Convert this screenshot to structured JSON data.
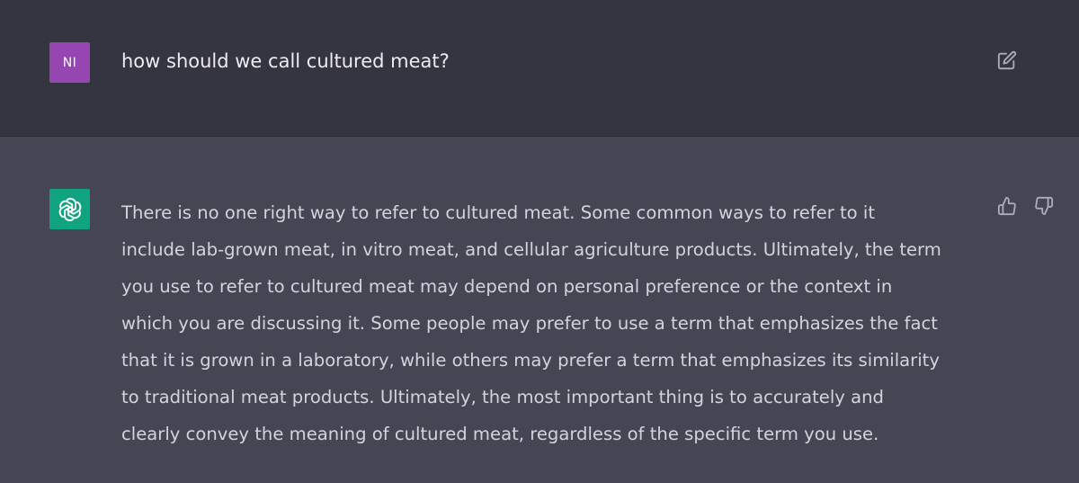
{
  "user_message": {
    "avatar_initials": "NI",
    "avatar_color": "#9646b0",
    "text": "how should we call cultured meat?",
    "edit_icon": "edit-icon"
  },
  "assistant_message": {
    "avatar_icon": "openai-logo-icon",
    "avatar_color": "#10a37f",
    "lines": [
      "There is no one right way to refer to cultured meat. Some common ways to refer to it",
      "include lab-grown meat, in vitro meat, and cellular agriculture products. Ultimately, the term",
      "you use to refer to cultured meat may depend on personal preference or the context in",
      "which you are discussing it. Some people may prefer to use a term that emphasizes the fact",
      "that it is grown in a laboratory, while others may prefer a term that emphasizes its similarity",
      "to traditional meat products. Ultimately, the most important thing is to accurately and",
      "clearly convey the meaning of cultured meat, regardless of the specific term you use."
    ],
    "feedback_icons": [
      "thumbs-up-icon",
      "thumbs-down-icon"
    ]
  },
  "colors": {
    "user_row_bg": "#343541",
    "assistant_row_bg": "#444654",
    "user_text": "#ececf1",
    "assistant_text": "#d1d5db",
    "icon": "#acacbe"
  }
}
